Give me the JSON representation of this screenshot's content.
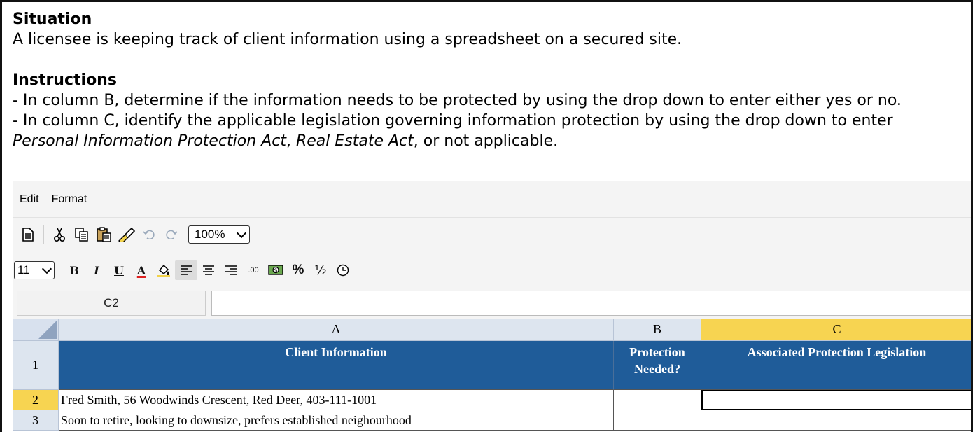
{
  "situation": {
    "heading": "Situation",
    "text": "A licensee is keeping track of client information using a spreadsheet on a secured site."
  },
  "instructions": {
    "heading": "Instructions",
    "line1": "- In column B, determine if the information needs to be protected by using the drop down to enter either yes or no.",
    "line2": "- In column C, identify the applicable legislation governing information protection by using the drop down to enter",
    "line3_italic1": "Personal Information Protection Act",
    "line3_sep": ", ",
    "line3_italic2": "Real Estate Act",
    "line3_tail": ", or not applicable."
  },
  "menu": {
    "edit": "Edit",
    "format": "Format"
  },
  "toolbar": {
    "zoom": "100%",
    "font_size": "11",
    "bold": "B",
    "italic": "I",
    "underline": "U",
    "font_color": "A",
    "decimal": ".00",
    "percent": "%",
    "fraction": "½"
  },
  "formula_bar": {
    "cell_ref": "C2",
    "value": ""
  },
  "grid": {
    "columns": [
      "A",
      "B",
      "C"
    ],
    "selected_column": "C",
    "rows": [
      "1",
      "2",
      "3"
    ],
    "selected_row": "2",
    "header_row": {
      "a": "Client Information",
      "b": "Protection Needed?",
      "c": "Associated Protection Legislation"
    },
    "row2": {
      "a": "Fred Smith, 56 Woodwinds Crescent, Red Deer, 403-111-1001",
      "b": "",
      "c": ""
    },
    "row3": {
      "a": "Soon to retire, looking to downsize, prefers established neighourhood",
      "b": "",
      "c": ""
    }
  },
  "colors": {
    "header_blue": "#1f5c99",
    "selection_yellow": "#f7d451",
    "header_gray": "#dde5ef"
  }
}
